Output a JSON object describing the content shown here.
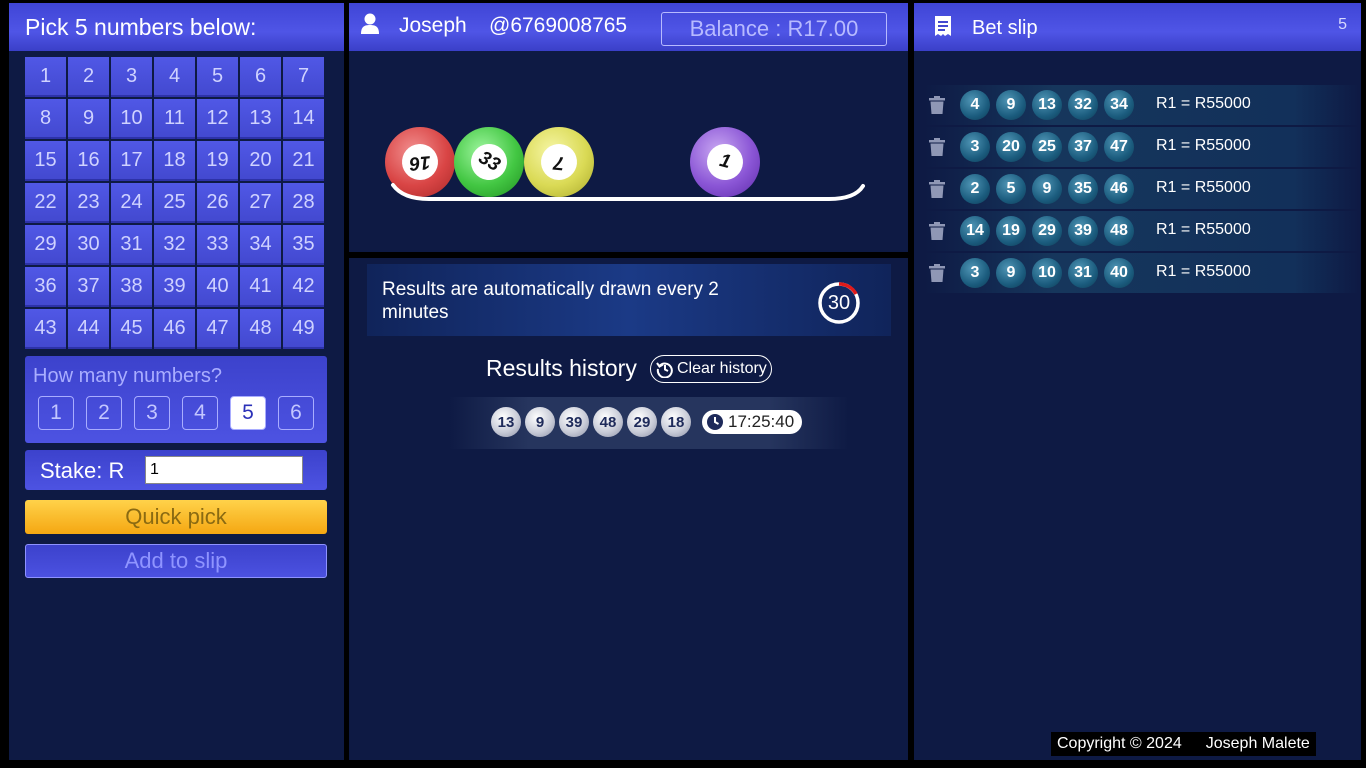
{
  "picker": {
    "title": "Pick 5 numbers below:",
    "numbers": [
      "1",
      "2",
      "3",
      "4",
      "5",
      "6",
      "7",
      "8",
      "9",
      "10",
      "11",
      "12",
      "13",
      "14",
      "15",
      "16",
      "17",
      "18",
      "19",
      "20",
      "21",
      "22",
      "23",
      "24",
      "25",
      "26",
      "27",
      "28",
      "29",
      "30",
      "31",
      "32",
      "33",
      "34",
      "35",
      "36",
      "37",
      "38",
      "39",
      "40",
      "41",
      "42",
      "43",
      "44",
      "45",
      "46",
      "47",
      "48",
      "49"
    ],
    "how_many_label": "How many numbers?",
    "counts": [
      "1",
      "2",
      "3",
      "4",
      "5",
      "6"
    ],
    "selected_count": "5",
    "stake_label": "Stake: R",
    "stake_value": "1",
    "quick_pick_label": "Quick pick",
    "add_to_slip_label": "Add to slip"
  },
  "user": {
    "name": "Joseph",
    "phone": "@6769008765",
    "balance": "Balance : R17.00"
  },
  "draw": {
    "balls": [
      {
        "number": "16",
        "color": "red"
      },
      {
        "number": "33",
        "color": "green"
      },
      {
        "number": "7",
        "color": "yellow"
      },
      {
        "number": "1",
        "color": "purple"
      }
    ]
  },
  "results": {
    "notice": "Results are automatically drawn every 2 minutes",
    "countdown": "30",
    "history_title": "Results history",
    "clear_label": "Clear history",
    "history": [
      {
        "numbers": [
          "13",
          "9",
          "39",
          "48",
          "29",
          "18"
        ],
        "time": "17:25:40"
      }
    ]
  },
  "slip": {
    "title": "Bet slip",
    "count": "5",
    "bets": [
      {
        "numbers": [
          "4",
          "9",
          "13",
          "32",
          "34"
        ],
        "payout": "R1 = R55000"
      },
      {
        "numbers": [
          "3",
          "20",
          "25",
          "37",
          "47"
        ],
        "payout": "R1 = R55000"
      },
      {
        "numbers": [
          "2",
          "5",
          "9",
          "35",
          "46"
        ],
        "payout": "R1 = R55000"
      },
      {
        "numbers": [
          "14",
          "19",
          "29",
          "39",
          "48"
        ],
        "payout": "R1 = R55000"
      },
      {
        "numbers": [
          "3",
          "9",
          "10",
          "31",
          "40"
        ],
        "payout": "R1 = R55000"
      }
    ]
  },
  "footer": {
    "copyright": "Copyright © 2024",
    "author": "Joseph Malete"
  }
}
